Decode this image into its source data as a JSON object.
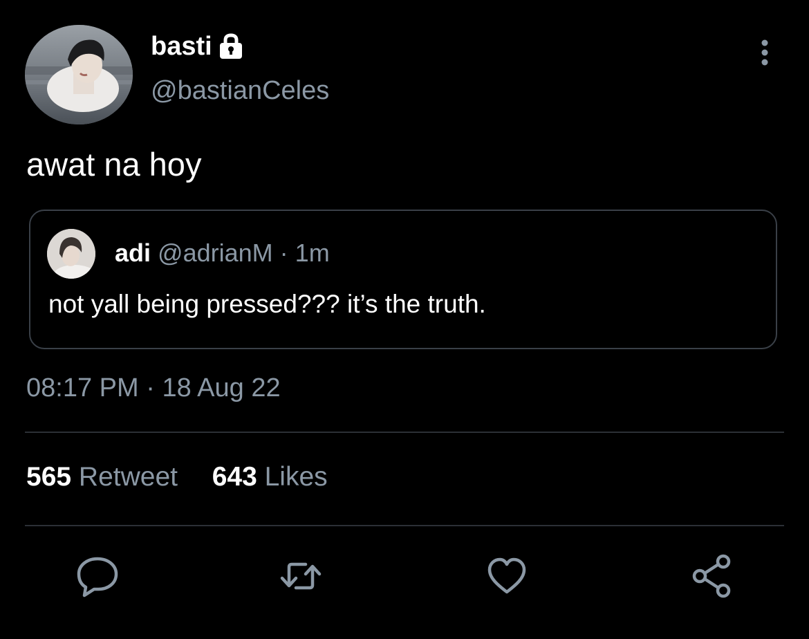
{
  "author": {
    "display_name": "basti",
    "handle": "@bastianCeles",
    "protected_icon": "lock-icon"
  },
  "tweet": {
    "text": "awat na hoy"
  },
  "quote": {
    "name": "adi",
    "handle": "@adrianM",
    "separator": "·",
    "time": "1m",
    "text": "not yall being pressed??? it’s the truth."
  },
  "meta": {
    "time": "08:17 PM",
    "separator": "·",
    "date": "18 Aug 22"
  },
  "stats": {
    "retweets_count": "565",
    "retweets_label": "Retweet",
    "likes_count": "643",
    "likes_label": "Likes"
  },
  "actions": [
    {
      "icon": "reply-icon"
    },
    {
      "icon": "retweet-icon"
    },
    {
      "icon": "like-icon"
    },
    {
      "icon": "share-icon"
    }
  ],
  "colors": {
    "background": "#000000",
    "primary_text": "#ffffff",
    "secondary_text": "#8b98a5",
    "border": "#3a4048"
  }
}
